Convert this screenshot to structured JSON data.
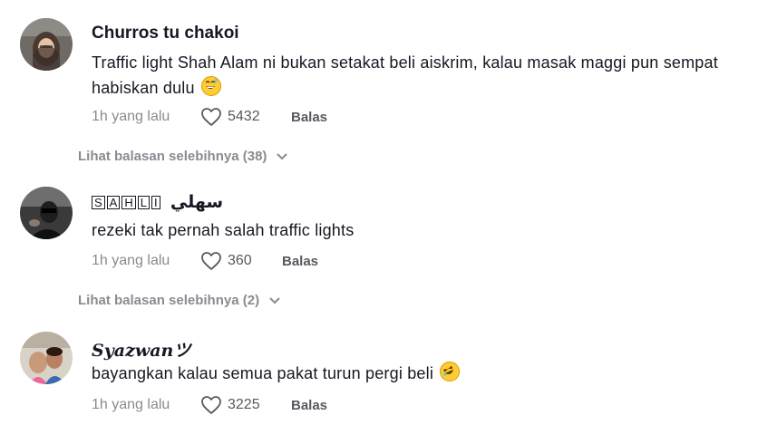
{
  "comments": [
    {
      "username": "Churros tu chakoi",
      "text": "Traffic light Shah Alam ni bukan setakat beli aiskrim, kalau masak maggi pun sempat habiskan dulu",
      "emoji": "grinning-sweat-emoji",
      "time": "1h yang lalu",
      "likes": "5432",
      "reply_label": "Balas",
      "more_replies": "Lihat balasan selebihnya (38)"
    },
    {
      "username_boxed": [
        "S",
        "A",
        "H",
        "L",
        "I"
      ],
      "username_arabic": "سهلي",
      "text": "rezeki tak pernah salah traffic lights",
      "time": "1h yang lalu",
      "likes": "360",
      "reply_label": "Balas",
      "more_replies": "Lihat balasan selebihnya (2)"
    },
    {
      "username": "Syazwanツ",
      "text": "bayangkan kalau semua pakat turun pergi beli",
      "emoji": "rolling-laughing-emoji",
      "time": "1h yang lalu",
      "likes": "3225",
      "reply_label": "Balas"
    }
  ]
}
